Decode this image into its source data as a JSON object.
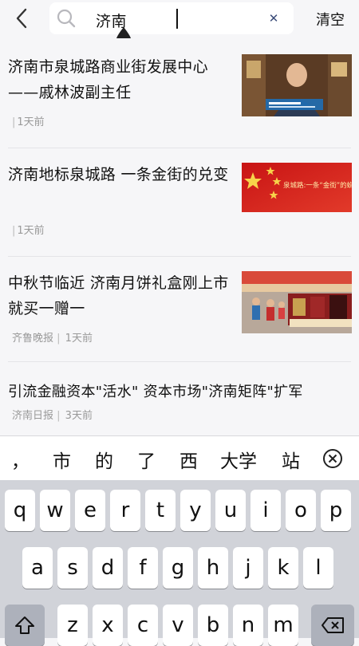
{
  "header": {
    "back_icon": "chevron-left-icon",
    "search_icon": "search-icon",
    "query": "济南",
    "clear_icon": "close-icon",
    "clear_label": "清空"
  },
  "news": [
    {
      "title": "济南市泉城路商业街发展中心——戚林波副主任",
      "source": "",
      "time": "1天前"
    },
    {
      "title": "济南地标泉城路 一条金街的兑变",
      "source": "",
      "time": "1天前",
      "thumb_text": "泉城路:一条“金街”的蜕变"
    },
    {
      "title": "中秋节临近 济南月饼礼盒刚上市就买一赠一",
      "source": "齐鲁晚报",
      "time": "1天前"
    },
    {
      "title": "引流金融资本\"活水\" 资本市场\"济南矩阵\"扩军",
      "source": "济南日报",
      "time": "3天前"
    }
  ],
  "keyboard": {
    "suggestions": [
      "，",
      "市",
      "的",
      "了",
      "西",
      "大学",
      "站"
    ],
    "suggest_delete_icon": "circle-x-icon",
    "row1": [
      "q",
      "w",
      "e",
      "r",
      "t",
      "y",
      "u",
      "i",
      "o",
      "p"
    ],
    "row2": [
      "a",
      "s",
      "d",
      "f",
      "g",
      "h",
      "j",
      "k",
      "l"
    ],
    "row3": [
      "z",
      "x",
      "c",
      "v",
      "b",
      "n",
      "m"
    ],
    "shift_icon": "shift-icon",
    "backspace_icon": "backspace-icon"
  },
  "colors": {
    "background": "#f6f6f8",
    "meta_text": "#999999",
    "clear_x": "#3a4b78",
    "keyboard_bg": "#d1d3d9"
  }
}
